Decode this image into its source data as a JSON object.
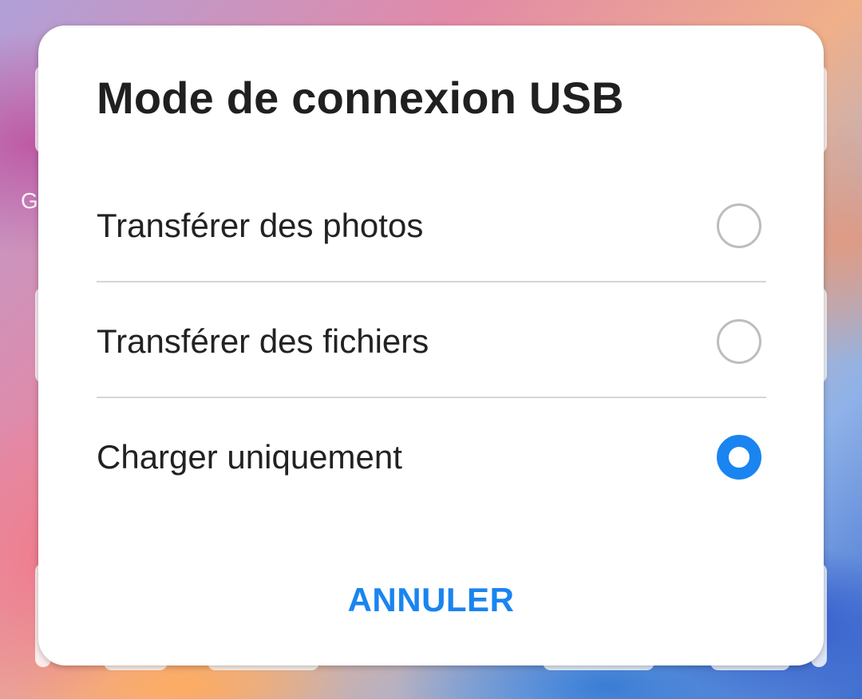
{
  "background": {
    "partial_letter": "G"
  },
  "dialog": {
    "title": "Mode de connexion USB",
    "options": [
      {
        "label": "Transférer des photos",
        "selected": false
      },
      {
        "label": "Transférer des fichiers",
        "selected": false
      },
      {
        "label": "Charger uniquement",
        "selected": true
      }
    ],
    "cancel_label": "ANNULER"
  },
  "colors": {
    "accent": "#1a84f0",
    "dialog_background": "#ffffff",
    "text": "#222222",
    "radio_unselected_border": "#bdbdbd"
  },
  "icons": {
    "unselected": "radio-unchecked-icon",
    "selected": "radio-checked-icon"
  }
}
